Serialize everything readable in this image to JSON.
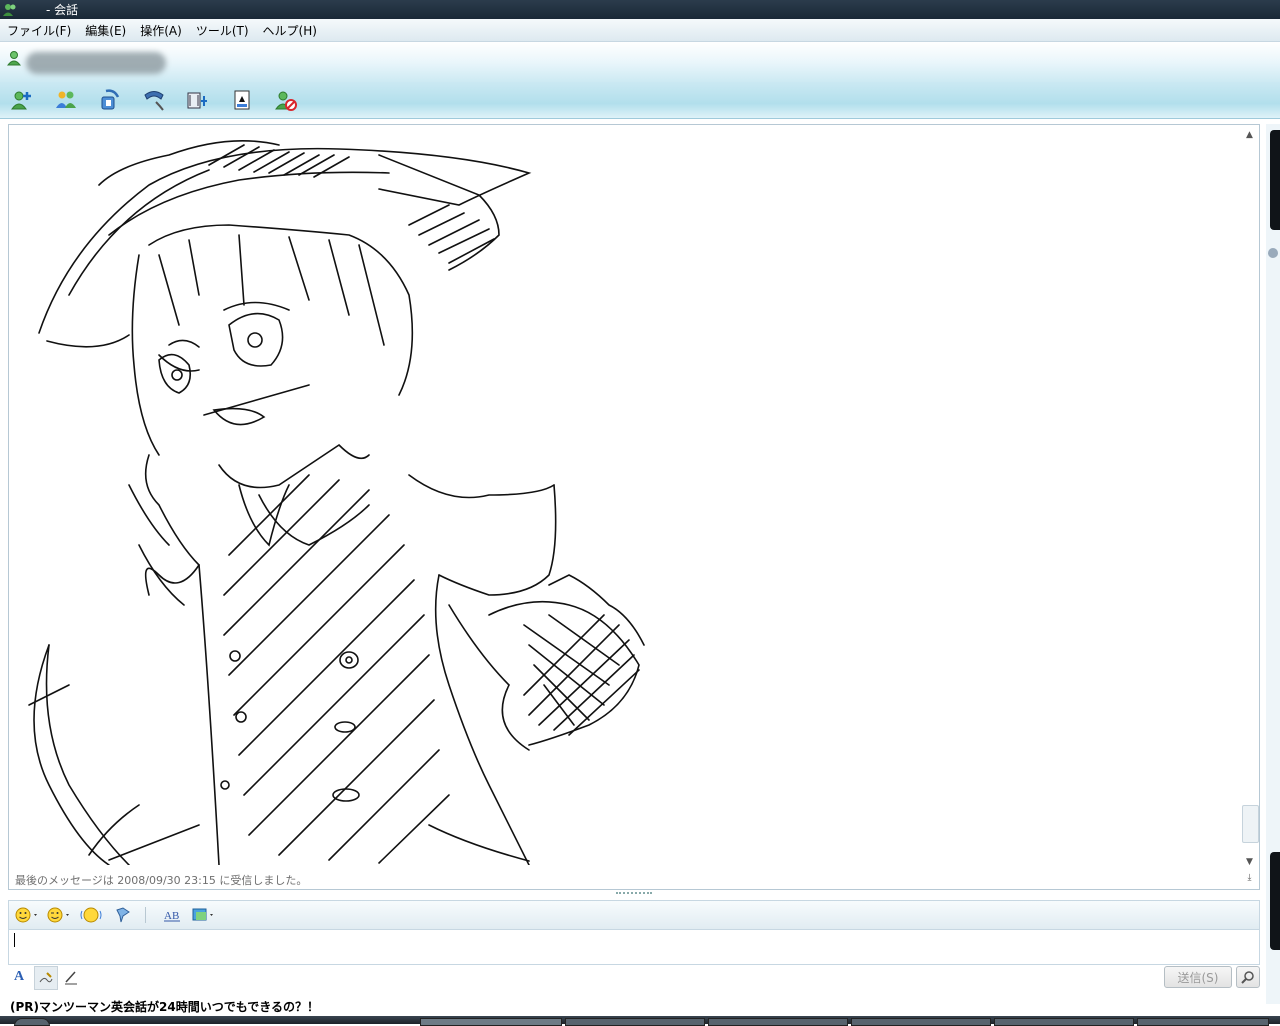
{
  "window": {
    "title": "- 会話"
  },
  "menu": {
    "items": [
      "ファイル(F)",
      "編集(E)",
      "操作(A)",
      "ツール(T)",
      "ヘルプ(H)"
    ]
  },
  "toolbar": {
    "icons": [
      "invite-contact-icon",
      "share-folders-icon",
      "video-call-icon",
      "phone-call-icon",
      "video-clip-icon",
      "games-icon",
      "block-contact-icon"
    ]
  },
  "conversation": {
    "last_message_status": "最後のメッセージは 2008/09/30 23:15 に受信しました。"
  },
  "compose": {
    "input_value": "",
    "send_label": "送信(S)"
  },
  "ad": {
    "text": "(PR)マンツーマン英会話が24時間いつでもできるの？！"
  },
  "colors": {
    "title_bar": "#1a2836",
    "toolbar_accent": "#b2dfec",
    "border": "#c7d7e2"
  }
}
